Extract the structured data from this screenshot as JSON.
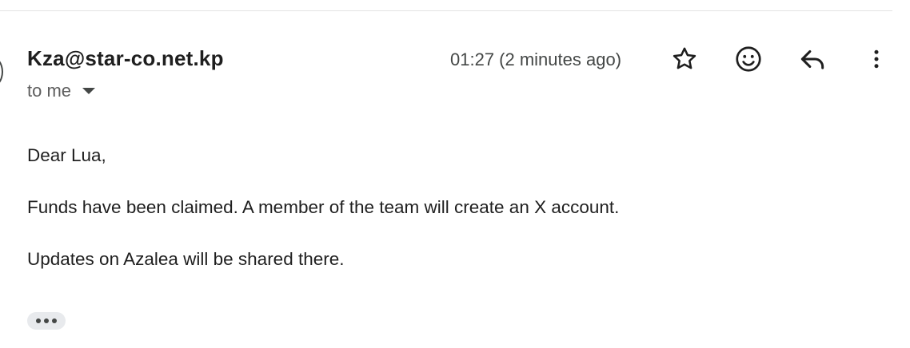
{
  "message": {
    "sender": "Kza@star-co.net.kp",
    "recipient_label": "to me",
    "timestamp": "01:27 (2 minutes ago)",
    "body": {
      "greeting": "Dear Lua,",
      "paragraph_1": "Funds have been claimed. A member of the team will create an X account.",
      "paragraph_2": "Updates on Azalea will be shared there."
    }
  },
  "actions": {
    "icons": [
      "star-icon",
      "emoji-icon",
      "reply-icon",
      "more-vert-icon"
    ]
  },
  "colors": {
    "text_primary": "#1f1f1f",
    "text_secondary": "#444746",
    "pill_background": "#e8eaed"
  }
}
